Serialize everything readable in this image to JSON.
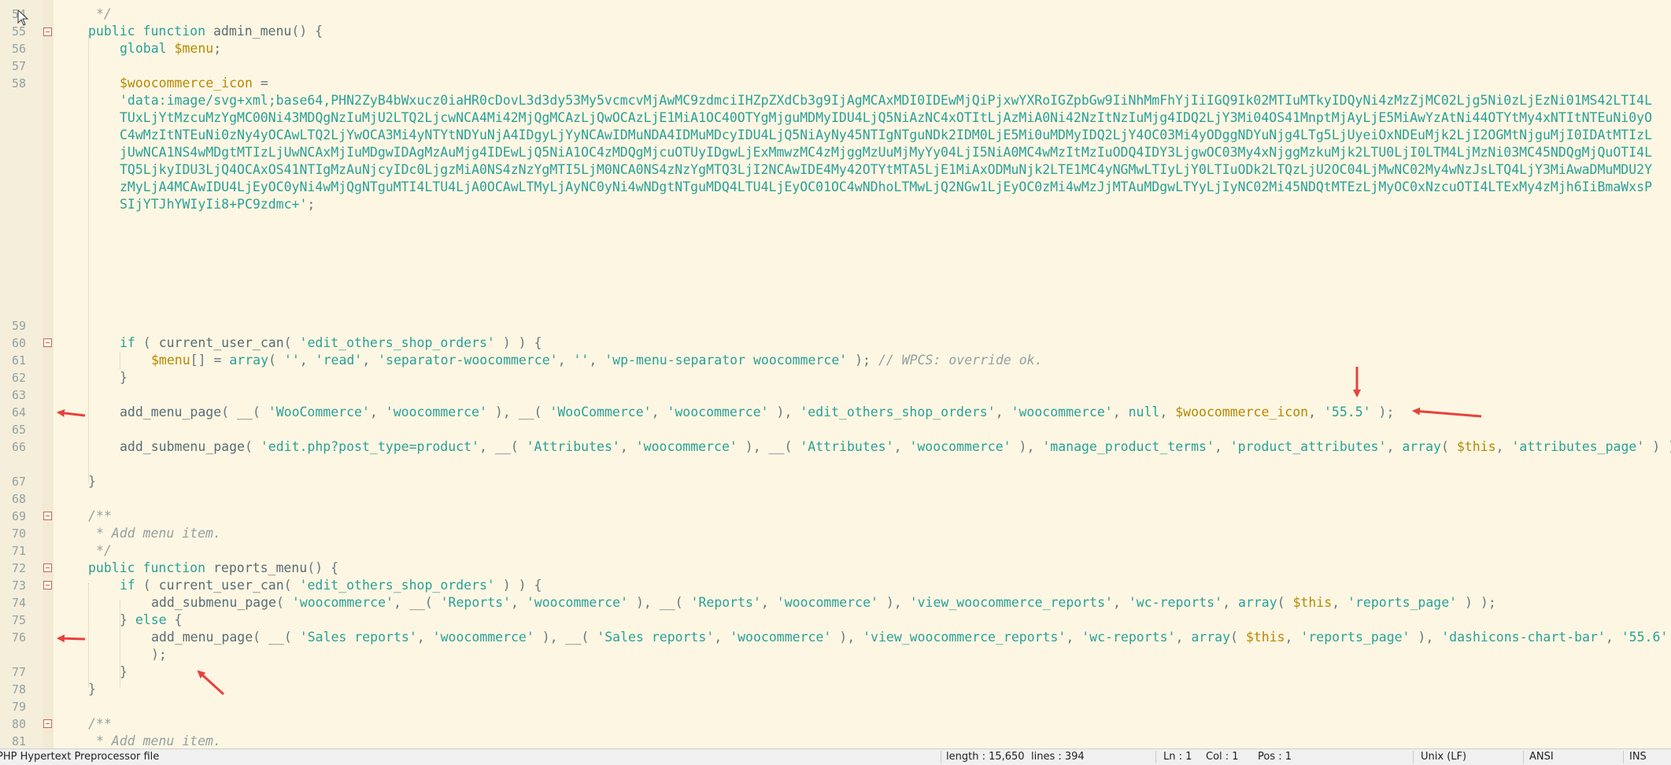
{
  "editor": {
    "lines": {
      "l54": {
        "num": "54",
        "comment": " */"
      },
      "l55": {
        "num": "55",
        "kw1": "public",
        "kw2": "function",
        "fn": "admin_menu",
        "rest": "() {"
      },
      "l56": {
        "num": "56",
        "kw": "global",
        "var": "$menu",
        "rest": ";"
      },
      "l57": {
        "num": "57"
      },
      "l58": {
        "num": "58",
        "var": "$woocommerce_icon",
        "rest": " =",
        "data": "'data:image/svg+xml;base64,PHN2ZyB4bWxucz0iaHR0cDovL3d3dy53My5vcmcvMjAwMC9zdmciIHZpZXdCb3g9IjAgMCAxMDI0IDEwMjQiPjxwYXRoIGZpbGw9IiNhMmFhYjIiIGQ9Ik02MTIuMTkyIDQyNi4zMzZjMC02Ljg5Ni0zLjEzNi01MS42LTI4LTUxLjYtMzcuMzYgMC00Ni43MDQgNzIuMjU2LTQ2LjcwNCA4Mi42MjQgMCAzLjQwOCAzLjE1MiA1OC40OTYgMjguMDMyIDU4LjQ5NiAzNC4xOTItLjAzMiA0Ni42NzItNzIuMjg4IDQ2LjY3Mi04OS41MnptMjAyLjE5MiAwYzAtNi44OTYtMy4xNTItNTEuNi0yOC4wMzItNTEuNi0zNy4yOCAwLTQ2LjYwOCA3Mi4yNTYtNDYuNjA4IDgyLjYyNCAwIDMuNDA4IDMuMDcyIDU4LjQ5NiAyNy45NTIgNTguNDk2IDM0LjE5Mi0uMDMyIDQ2LjY4OC03Mi4yODggNDYuNjg4LTg5LjUyeiOxNDEuMjk2LjI2OGMtNjguMjI0IDAtMTIzLjUwNCA1NS4wMDgtMTIzLjUwNCAxMjIuMDgwIDAgMzAuMjg4IDEwLjQ5NiA1OC4zMDQgMjcuOTUyIDgwLjExMmwzMC4zMjggMzUuMjMyYy04LjI5NiA0MC4wMzItMzIuODQ4IDY3LjgwOC03My4xNjggMzkuMjk2LTU0LjI0LTM4LjMzNi03MC45NDQgMjQuOTI4LTQ5LjkyIDU3LjQ4OCAxOS41NTIgMzAuNjcyIDc0LjgzMiA0NS4zNzYgMTI5LjM0NCA0NS4zNzYgMTQ3LjI2NCAwIDE4My42OTYtMTA5LjE1MiAxODMuNjk2LTE1MC4yNGMwLTIyLjY0LTIuODk2LTQzLjU2OC04LjMwNC02My4wNzJsLTQ4LjY3MiAwaDMuMDU2YzMyLjA4MCAwIDU4LjEyOC0yNi4wMjQgNTguMTI4LTU4LjA0OCAwLTMyLjAyNC0yNi4wNDgtNTguMDQ4LTU4LjEyOC01OC4wNDhoLTMwLjQ2NGw1LjEyOC0zMi4wMzJjMTAuMDgwLTYyLjIyNC02Mi45NDQtMTEzLjMyOC0xNzcuOTI4LTExMy4zMjh6IiBmaWxsPSIjYTJhYWIyIi8+PC9zdmc+'",
        "data_end": ";"
      },
      "l59": {
        "num": "59"
      },
      "l60": {
        "num": "60",
        "kw": "if",
        "p1": " ( ",
        "fn": "current_user_can",
        "p2": "( ",
        "s1": "'edit_others_shop_orders'",
        "p3": " ) ) {"
      },
      "l61": {
        "num": "61",
        "var": "$menu",
        "p1": "[] = ",
        "kw": "array",
        "p2": "( ",
        "s1": "''",
        "c1": ", ",
        "s2": "'read'",
        "c2": ", ",
        "s3": "'separator-woocommerce'",
        "c3": ", ",
        "s4": "''",
        "c4": ", ",
        "s5": "'wp-menu-separator woocommerce'",
        "p3": " ); ",
        "cmt": "// WPCS: override ok."
      },
      "l62": {
        "num": "62",
        "rest": "}"
      },
      "l63": {
        "num": "63"
      },
      "l64": {
        "num": "64",
        "fn": "add_menu_page",
        "p1": "( ",
        "fn2": "__",
        "p2": "( ",
        "s1": "'WooCommerce'",
        "c1": ", ",
        "s2": "'woocommerce'",
        "p3": " ), ",
        "fn3": "__",
        "p4": "( ",
        "s3": "'WooCommerce'",
        "c2": ", ",
        "s4": "'woocommerce'",
        "p5": " ), ",
        "s5": "'edit_others_shop_orders'",
        "c3": ", ",
        "s6": "'woocommerce'",
        "c4": ", ",
        "kw": "null",
        "c5": ", ",
        "var": "$woocommerce_icon",
        "c6": ", ",
        "s7": "'55.5'",
        "p6": " );"
      },
      "l65": {
        "num": "65"
      },
      "l66": {
        "num": "66",
        "fn": "add_submenu_page",
        "p1": "( ",
        "s1": "'edit.php?post_type=product'",
        "c1": ", ",
        "fn2": "__",
        "p2": "( ",
        "s2": "'Attributes'",
        "c2": ", ",
        "s3": "'woocommerce'",
        "p3": " ), ",
        "fn3": "__",
        "p4": "( ",
        "s4": "'Attributes'",
        "c3": ", ",
        "s5": "'woocommerce'",
        "p5": " ), ",
        "s6": "'manage_product_terms'",
        "c4": ", ",
        "s7": "'product_attributes'",
        "c5": ", ",
        "kw": "array",
        "p6": "( ",
        "var": "$this",
        "c6": ", ",
        "s8": "'attributes_page'",
        "p7": " ) );"
      },
      "l67": {
        "num": "67",
        "rest": "}"
      },
      "l68": {
        "num": "68"
      },
      "l69": {
        "num": "69",
        "comment": "/**"
      },
      "l70": {
        "num": "70",
        "comment": " * Add menu item."
      },
      "l71": {
        "num": "71",
        "comment": " */"
      },
      "l72": {
        "num": "72",
        "kw1": "public",
        "kw2": "function",
        "fn": "reports_menu",
        "rest": "() {"
      },
      "l73": {
        "num": "73",
        "kw": "if",
        "p1": " ( ",
        "fn": "current_user_can",
        "p2": "( ",
        "s1": "'edit_others_shop_orders'",
        "p3": " ) ) {"
      },
      "l74": {
        "num": "74",
        "fn": "add_submenu_page",
        "p1": "( ",
        "s1": "'woocommerce'",
        "c1": ", ",
        "fn2": "__",
        "p2": "( ",
        "s2": "'Reports'",
        "c2": ", ",
        "s3": "'woocommerce'",
        "p3": " ), ",
        "fn3": "__",
        "p4": "( ",
        "s4": "'Reports'",
        "c3": ", ",
        "s5": "'woocommerce'",
        "p5": " ), ",
        "s6": "'view_woocommerce_reports'",
        "c4": ", ",
        "s7": "'wc-reports'",
        "c5": ", ",
        "kw": "array",
        "p6": "( ",
        "var": "$this",
        "c6": ", ",
        "s8": "'reports_page'",
        "p7": " ) );"
      },
      "l75": {
        "num": "75",
        "p1": "} ",
        "kw": "else",
        "p2": " {"
      },
      "l76": {
        "num": "76",
        "fn": "add_menu_page",
        "p1": "( ",
        "fn2": "__",
        "p2": "( ",
        "s1": "'Sales reports'",
        "c1": ", ",
        "s2": "'woocommerce'",
        "p3": " ), ",
        "fn3": "__",
        "p4": "( ",
        "s3": "'Sales reports'",
        "c2": ", ",
        "s4": "'woocommerce'",
        "p5": " ), ",
        "s5": "'view_woocommerce_reports'",
        "c3": ", ",
        "s6": "'wc-reports'",
        "c4": ", ",
        "kw": "array",
        "p6": "( ",
        "var": "$this",
        "c5": ", ",
        "s7": "'reports_page'",
        "p7": " ), ",
        "s8": "'dashicons-chart-bar'",
        "c6": ", ",
        "s9": "'55.6'",
        "p8": " );"
      },
      "l77": {
        "num": "77",
        "rest": "}"
      },
      "l78": {
        "num": "78",
        "rest": "}"
      },
      "l79": {
        "num": "79"
      },
      "l80": {
        "num": "80",
        "comment": "/**"
      },
      "l81": {
        "num": "81",
        "comment": " * Add menu item."
      }
    }
  },
  "statusbar": {
    "file_type": "PHP Hypertext Preprocessor file",
    "length": "length : 15,650",
    "lines": "lines : 394",
    "ln": "Ln : 1",
    "col": "Col : 1",
    "pos": "Pos : 1",
    "eol": "Unix (LF)",
    "encoding": "ANSI",
    "mode": "INS"
  },
  "colors": {
    "background": "#fdf6e3",
    "annotation_arrow": "#e8413c"
  },
  "icons": [
    "fold-collapse-icon",
    "mouse-cursor-icon",
    "annotation-arrow-icon"
  ]
}
